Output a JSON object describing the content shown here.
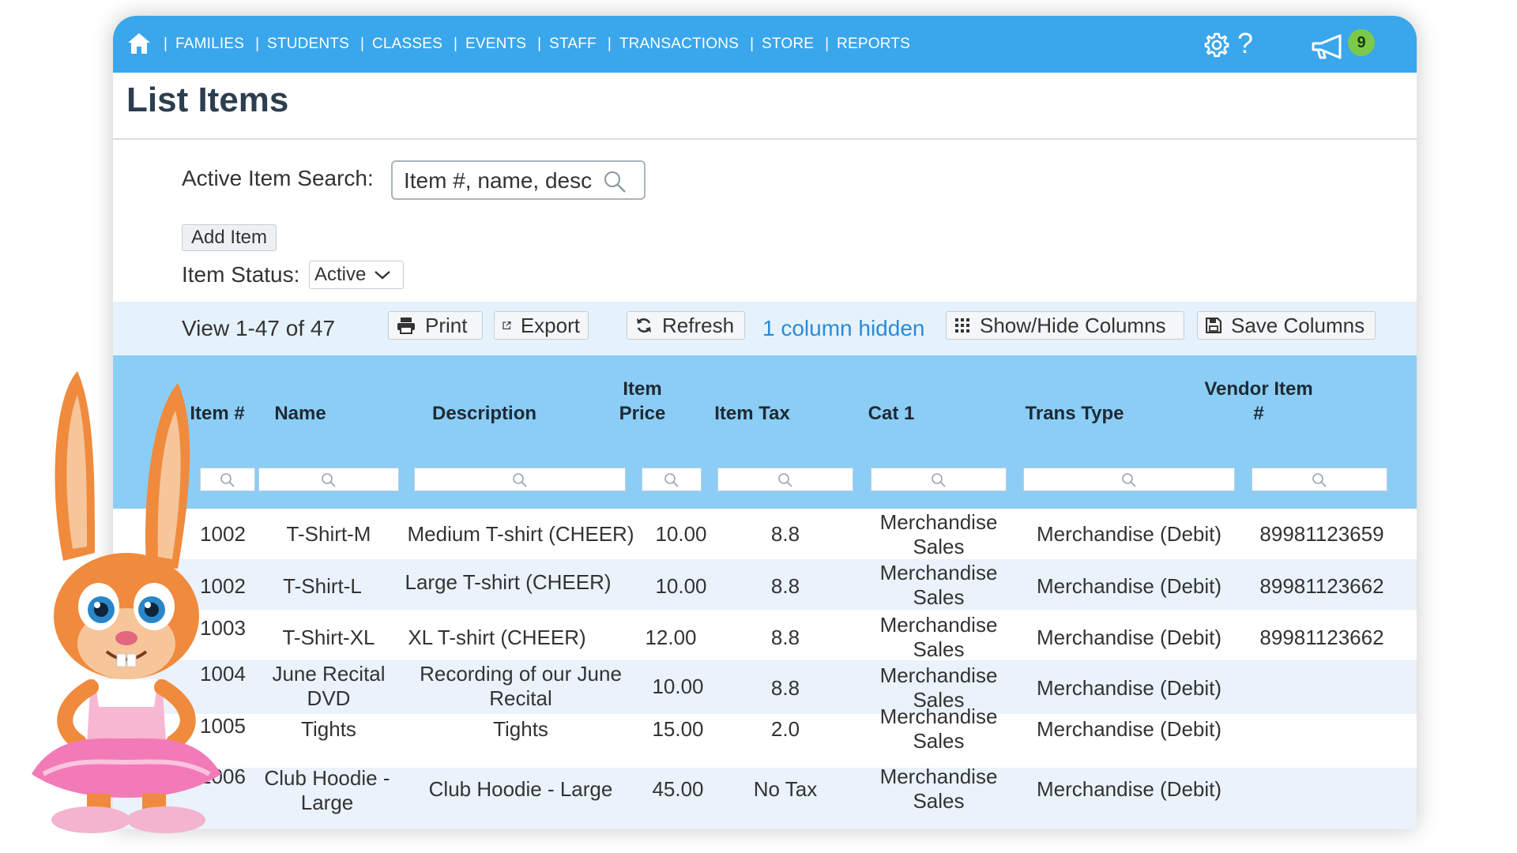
{
  "nav": {
    "links": [
      "FAMILIES",
      "STUDENTS",
      "CLASSES",
      "EVENTS",
      "STAFF",
      "TRANSACTIONS",
      "STORE",
      "REPORTS"
    ],
    "separator": "|",
    "help_glyph": "?",
    "notification_count": "9",
    "icons": [
      "home-icon",
      "gear-icon",
      "help-icon",
      "megaphone-icon"
    ]
  },
  "page": {
    "title": "List Items"
  },
  "search": {
    "label": "Active Item Search:",
    "placeholder": "Item #, name, desc"
  },
  "actions": {
    "add_item": "Add Item"
  },
  "status": {
    "label": "Item Status:",
    "selected": "Active"
  },
  "toolbar": {
    "view_count": "View 1-47 of 47",
    "print": "Print",
    "export": "Export",
    "refresh": "Refresh",
    "hidden_columns": "1 column hidden",
    "show_hide": "Show/Hide Columns",
    "save_columns": "Save Columns"
  },
  "table": {
    "headers": {
      "item_num": "Item #",
      "name": "Name",
      "description": "Description",
      "price_1": "Item",
      "price_2": "Price",
      "tax": "Item Tax",
      "cat1": "Cat 1",
      "trans_type": "Trans Type",
      "vendor_1": "Vendor Item",
      "vendor_2": "#"
    },
    "rows": [
      {
        "item": "1002",
        "name_1": "T-Shirt-M",
        "name_2": "",
        "desc_1": "Medium T-shirt (CHEER)",
        "desc_2": "",
        "price": "10.00",
        "tax": "8.8",
        "cat_1": "Merchandise",
        "cat_2": "Sales",
        "trans": "Merchandise (Debit)",
        "vendor": "89981123659"
      },
      {
        "item": "1002",
        "name_1": "T-Shirt-L",
        "name_2": "",
        "desc_1": "Large T-shirt (CHEER)",
        "desc_2": "",
        "price": "10.00",
        "tax": "8.8",
        "cat_1": "Merchandise",
        "cat_2": "Sales",
        "trans": "Merchandise (Debit)",
        "vendor": "89981123662"
      },
      {
        "item": "1003",
        "name_1": "T-Shirt-XL",
        "name_2": "",
        "desc_1": "XL T-shirt (CHEER)",
        "desc_2": "",
        "price": "12.00",
        "tax": "8.8",
        "cat_1": "Merchandise",
        "cat_2": "Sales",
        "trans": "Merchandise (Debit)",
        "vendor": "89981123662"
      },
      {
        "item": "1004",
        "name_1": "June Recital",
        "name_2": "DVD",
        "desc_1": "Recording of our June",
        "desc_2": "Recital",
        "price": "10.00",
        "tax": "8.8",
        "cat_1": "Merchandise",
        "cat_2": "Sales",
        "trans": "Merchandise (Debit)",
        "vendor": ""
      },
      {
        "item": "1005",
        "name_1": "Tights",
        "name_2": "",
        "desc_1": "Tights",
        "desc_2": "",
        "price": "15.00",
        "tax": "2.0",
        "cat_1": "Merchandise",
        "cat_2": "Sales",
        "trans": "Merchandise (Debit)",
        "vendor": ""
      },
      {
        "item": "1006",
        "name_1": "Club Hoodie -",
        "name_2": "Large",
        "desc_1": "Club Hoodie - Large",
        "desc_2": "",
        "price": "45.00",
        "tax": "No Tax",
        "cat_1": "Merchandise",
        "cat_2": "Sales",
        "trans": "Merchandise (Debit)",
        "vendor": ""
      }
    ]
  },
  "colors": {
    "nav_bg": "#3aa6ec",
    "toolbar_bg": "#e6f2fb",
    "header_bg": "#8ccdf5",
    "row_alt_bg": "#eaf2fb",
    "link": "#2a8ad8",
    "badge": "#7cc94a"
  }
}
